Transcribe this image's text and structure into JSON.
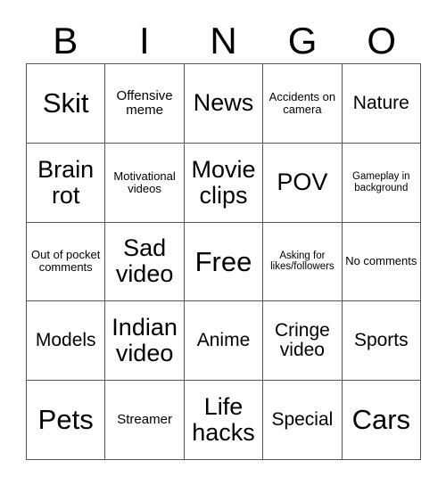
{
  "card": {
    "header_letters": [
      "B",
      "I",
      "N",
      "G",
      "O"
    ],
    "columns": 5,
    "rows": 5,
    "border_color": "#555555",
    "background_color": "#ffffff",
    "text_color": "#000000",
    "cells": [
      {
        "label": "Skit",
        "size": "xl"
      },
      {
        "label": "Offensive meme",
        "size": "sm"
      },
      {
        "label": "News",
        "size": "lg"
      },
      {
        "label": "Accidents on camera",
        "size": "xs"
      },
      {
        "label": "Nature",
        "size": "md"
      },
      {
        "label": "Brain rot",
        "size": "lg"
      },
      {
        "label": "Motivational videos",
        "size": "xs"
      },
      {
        "label": "Movie clips",
        "size": "lg"
      },
      {
        "label": "POV",
        "size": "lg"
      },
      {
        "label": "Gameplay in background",
        "size": "xxs"
      },
      {
        "label": "Out of pocket comments",
        "size": "xs"
      },
      {
        "label": "Sad video",
        "size": "lg"
      },
      {
        "label": "Free",
        "size": "xl"
      },
      {
        "label": "Asking for likes/followers",
        "size": "xxs"
      },
      {
        "label": "No comments",
        "size": "xs"
      },
      {
        "label": "Models",
        "size": "md"
      },
      {
        "label": "Indian video",
        "size": "lg"
      },
      {
        "label": "Anime",
        "size": "md"
      },
      {
        "label": "Cringe video",
        "size": "md"
      },
      {
        "label": "Sports",
        "size": "md"
      },
      {
        "label": "Pets",
        "size": "xl"
      },
      {
        "label": "Streamer",
        "size": "sm"
      },
      {
        "label": "Life hacks",
        "size": "lg"
      },
      {
        "label": "Special",
        "size": "md"
      },
      {
        "label": "Cars",
        "size": "xl"
      }
    ]
  }
}
